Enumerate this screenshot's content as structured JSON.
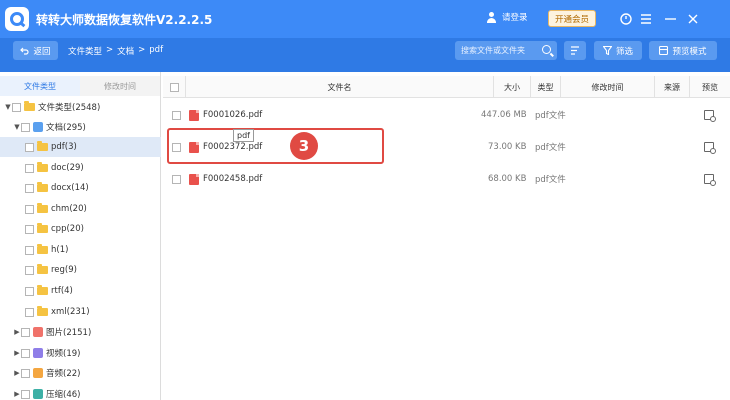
{
  "window": {
    "title": "转转大师数据恢复软件V2.2.2.5",
    "login": "请登录",
    "vip": "开通会员"
  },
  "toolbar": {
    "back": "返回",
    "breadcrumb": [
      "文件类型",
      ">",
      "文档",
      ">",
      "pdf"
    ],
    "search_placeholder": "搜索文件或文件夹",
    "filter": "筛选",
    "preview_mode": "预览模式"
  },
  "left_tabs": [
    "文件类型",
    "修改时间"
  ],
  "tree": [
    {
      "label": "文件类型(2548)"
    },
    {
      "label": "文档(295)"
    },
    {
      "label": "pdf(3)"
    },
    {
      "label": "doc(29)"
    },
    {
      "label": "docx(14)"
    },
    {
      "label": "chm(20)"
    },
    {
      "label": "cpp(20)"
    },
    {
      "label": "h(1)"
    },
    {
      "label": "reg(9)"
    },
    {
      "label": "rtf(4)"
    },
    {
      "label": "xml(231)"
    },
    {
      "label": "图片(2151)"
    },
    {
      "label": "视频(19)"
    },
    {
      "label": "音频(22)"
    },
    {
      "label": "压缩(46)"
    }
  ],
  "table": {
    "headers": {
      "name": "文件名",
      "size": "大小",
      "type": "类型",
      "mtime": "修改时间",
      "source": "来源",
      "preview": "预览"
    },
    "rows": [
      {
        "name": "F0001026.pdf",
        "size": "447.06 MB",
        "type": "pdf文件"
      },
      {
        "name": "F0002372.pdf",
        "size": "73.00 KB",
        "type": "pdf文件"
      },
      {
        "name": "F0002458.pdf",
        "size": "68.00 KB",
        "type": "pdf文件"
      }
    ]
  },
  "tooltip": "pdf",
  "step_badge": "3",
  "colors": {
    "titlebar": "#3d8af7",
    "toolbar": "#2f7ae5",
    "highlight": "#e04a43"
  }
}
